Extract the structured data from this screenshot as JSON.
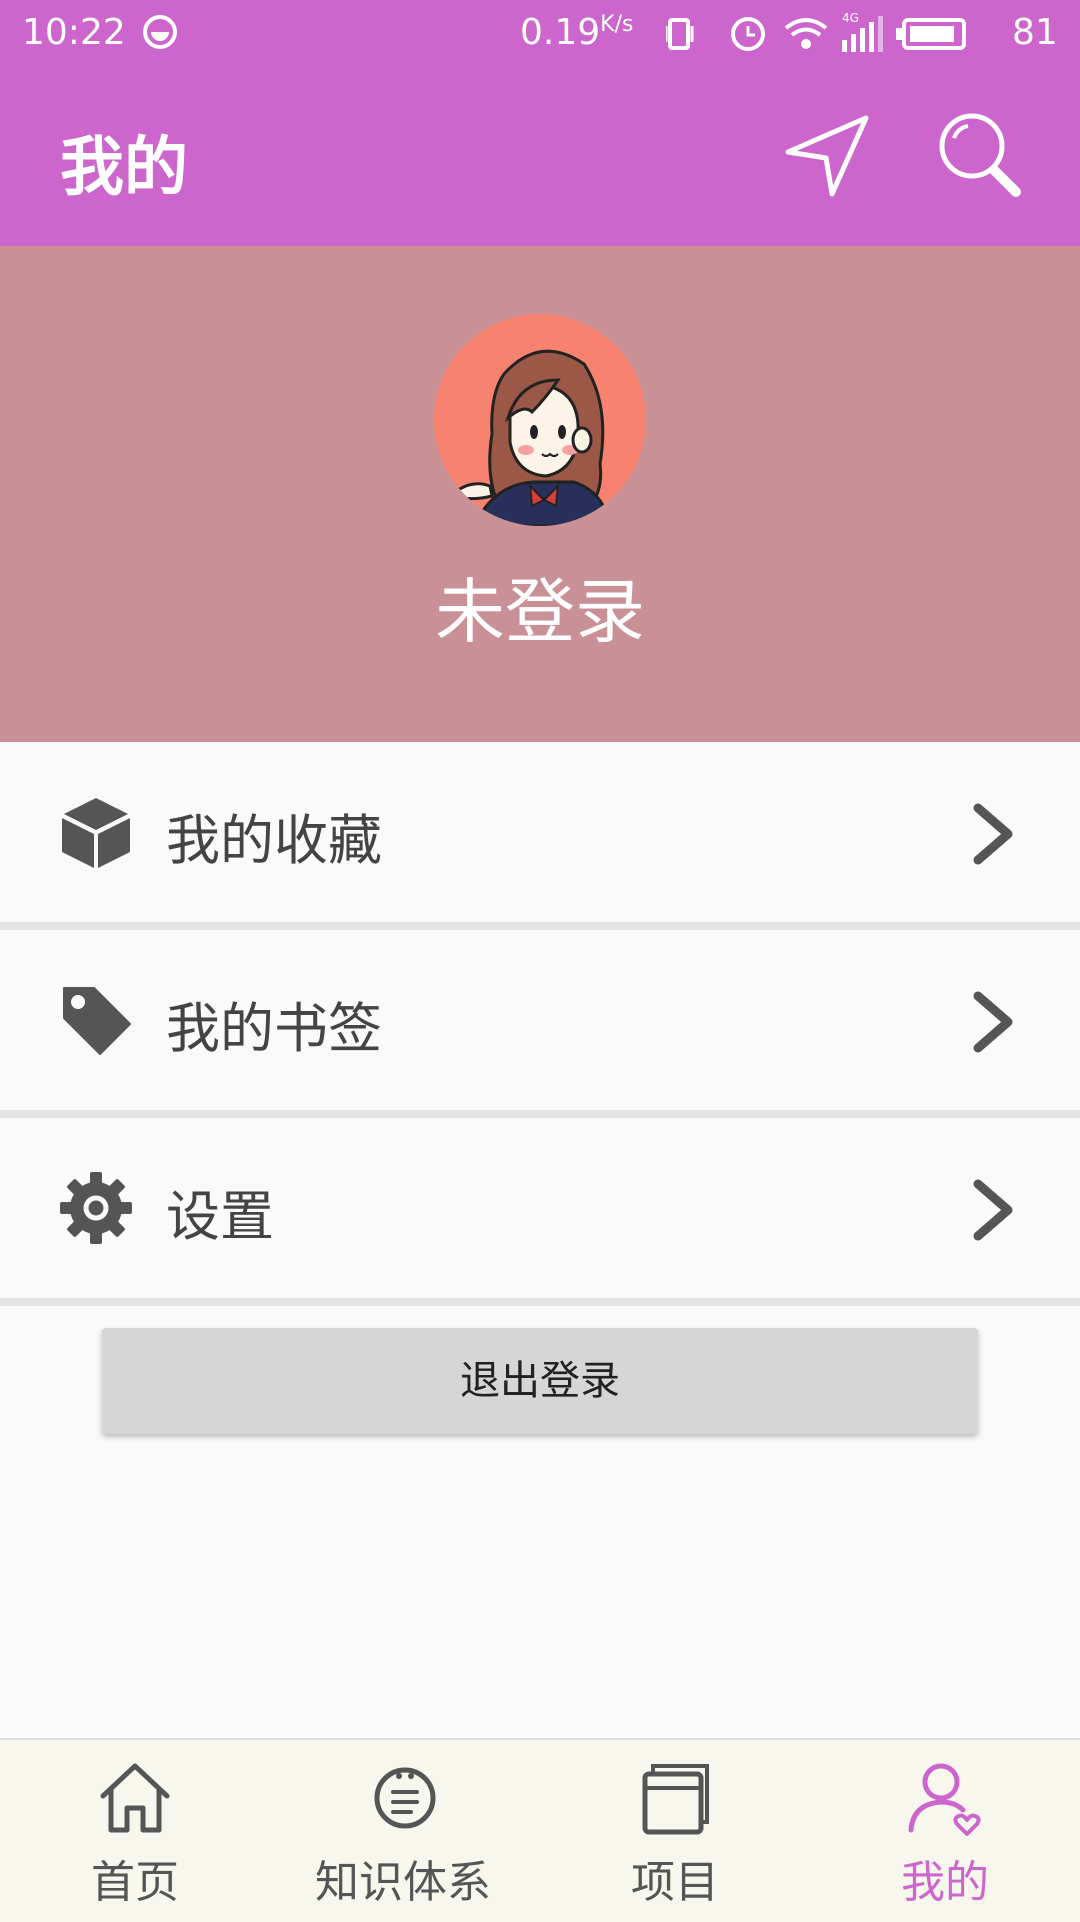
{
  "status_bar": {
    "time": "10:22",
    "net_speed": "0.19",
    "net_speed_unit": "K/s",
    "network_type": "4G",
    "battery_level": "81"
  },
  "app_bar": {
    "title": "我的",
    "background_color": "#cc66cc"
  },
  "profile": {
    "name": "未登录",
    "background_color": "#c99096"
  },
  "menu": {
    "items": [
      {
        "label": "我的收藏",
        "icon": "box-icon"
      },
      {
        "label": "我的书签",
        "icon": "tag-icon"
      },
      {
        "label": "设置",
        "icon": "gear-icon"
      }
    ]
  },
  "logout_label": "退出登录",
  "bottom_nav": {
    "active_color": "#cc66cc",
    "items": [
      {
        "label": "首页",
        "icon": "home-icon"
      },
      {
        "label": "知识体系",
        "icon": "list-circle-icon"
      },
      {
        "label": "项目",
        "icon": "project-icon"
      },
      {
        "label": "我的",
        "icon": "user-icon",
        "active": true
      }
    ]
  }
}
